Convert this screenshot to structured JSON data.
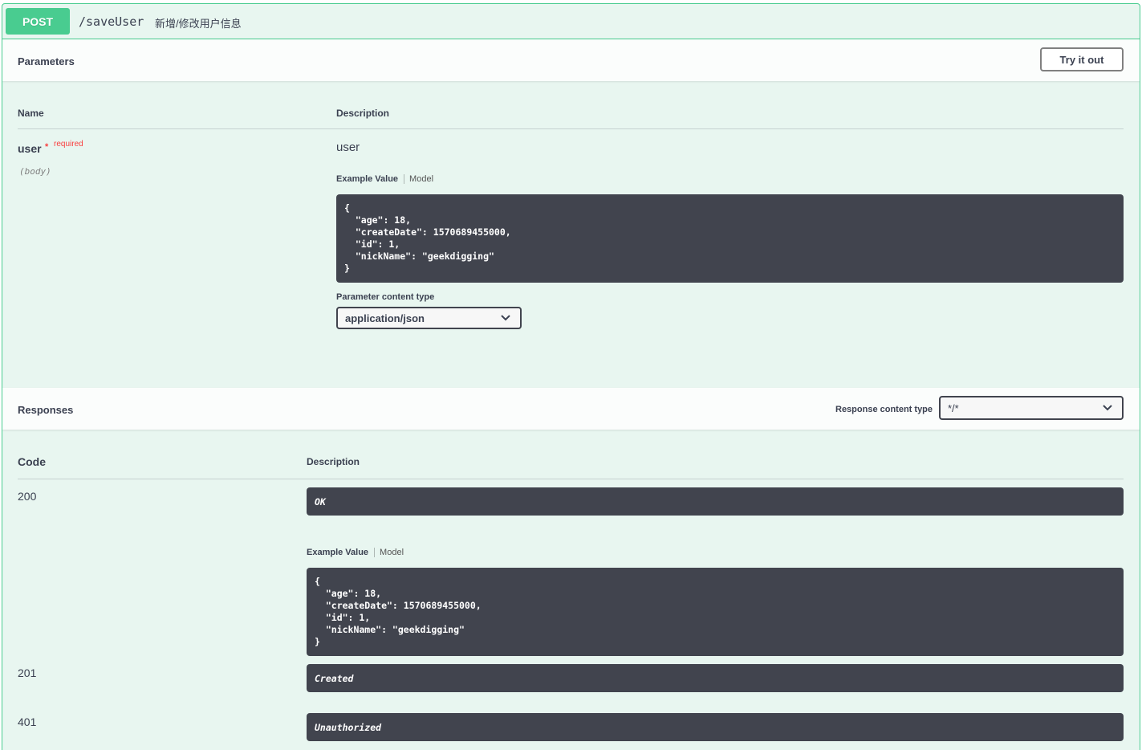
{
  "operation": {
    "method": "POST",
    "path": "/saveUser",
    "summary": "新增/修改用户信息"
  },
  "parameters_section": {
    "title": "Parameters",
    "try_it_out": "Try it out",
    "col_name": "Name",
    "col_description": "Description",
    "param": {
      "name": "user",
      "required_star": "*",
      "required_label": "required",
      "location": "(body)",
      "description": "user"
    },
    "tabs": {
      "example_value": "Example Value",
      "model": "Model"
    },
    "example_json": "{\n  \"age\": 18,\n  \"createDate\": 1570689455000,\n  \"id\": 1,\n  \"nickName\": \"geekdigging\"\n}",
    "content_type_label": "Parameter content type",
    "content_type_value": "application/json"
  },
  "responses_section": {
    "title": "Responses",
    "content_type_label": "Response content type",
    "content_type_value": "*/*",
    "col_code": "Code",
    "col_description": "Description",
    "tabs": {
      "example_value": "Example Value",
      "model": "Model"
    },
    "responses": [
      {
        "code": "200",
        "description": "OK"
      },
      {
        "code": "201",
        "description": "Created"
      },
      {
        "code": "401",
        "description": "Unauthorized"
      }
    ],
    "example_json": "{\n  \"age\": 18,\n  \"createDate\": 1570689455000,\n  \"id\": 1,\n  \"nickName\": \"geekdigging\"\n}"
  },
  "colors": {
    "post_green": "#49cc90",
    "block_bg": "#e8f6f0",
    "code_bg": "#41444e",
    "required_red": "#f93e3e"
  }
}
